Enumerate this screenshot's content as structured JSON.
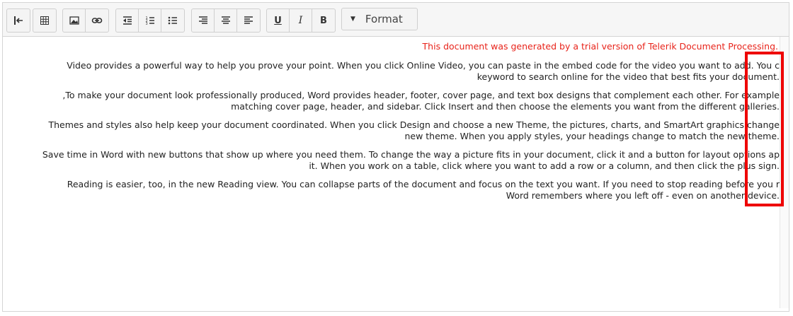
{
  "toolbar": {
    "format_label": "Format",
    "buttons": [
      "collapse-left",
      "table",
      "image",
      "link",
      "outdent",
      "numbered-list",
      "bulleted-list",
      "align-right",
      "align-center",
      "align-left",
      "underline",
      "italic",
      "bold"
    ],
    "u_label": "U",
    "i_label": "I",
    "b_label": "B"
  },
  "document": {
    "trial_notice": ".This document was generated by a trial version of Telerik Document Processing",
    "paragraphs": [
      {
        "line1": "Video provides a powerful way to help you prove your point. When you click Online Video, you can paste in the embed code for the video you want to add. You c",
        "line2": ".keyword to search online for the video that best fits your document"
      },
      {
        "line1": "To make your document look professionally produced, Word provides header, footer, cover page, and text box designs that complement each other. For example,",
        "line2": ".matching cover page, header, and sidebar. Click Insert and then choose the elements you want from the different galleries"
      },
      {
        "line1": "Themes and styles also help keep your document coordinated. When you click Design and choose a new Theme, the pictures, charts, and SmartArt graphics change",
        "line2": ".new theme. When you apply styles, your headings change to match the new theme"
      },
      {
        "line1": "Save time in Word with new buttons that show up where you need them. To change the way a picture fits in your document, click it and a button for layout options ap",
        "line2": ".it. When you work on a table, click where you want to add a row or a column, and then click the plus sign"
      },
      {
        "line1": "Reading is easier, too, in the new Reading view. You can collapse parts of the document and focus on the text you want. If you need to stop reading before you r",
        "line2": ".Word remembers where you left off - even on another device"
      }
    ]
  },
  "colors": {
    "trial_notice": "#e8231a",
    "highlight_box": "#ee0000",
    "toolbar_bg": "#f6f6f6"
  }
}
